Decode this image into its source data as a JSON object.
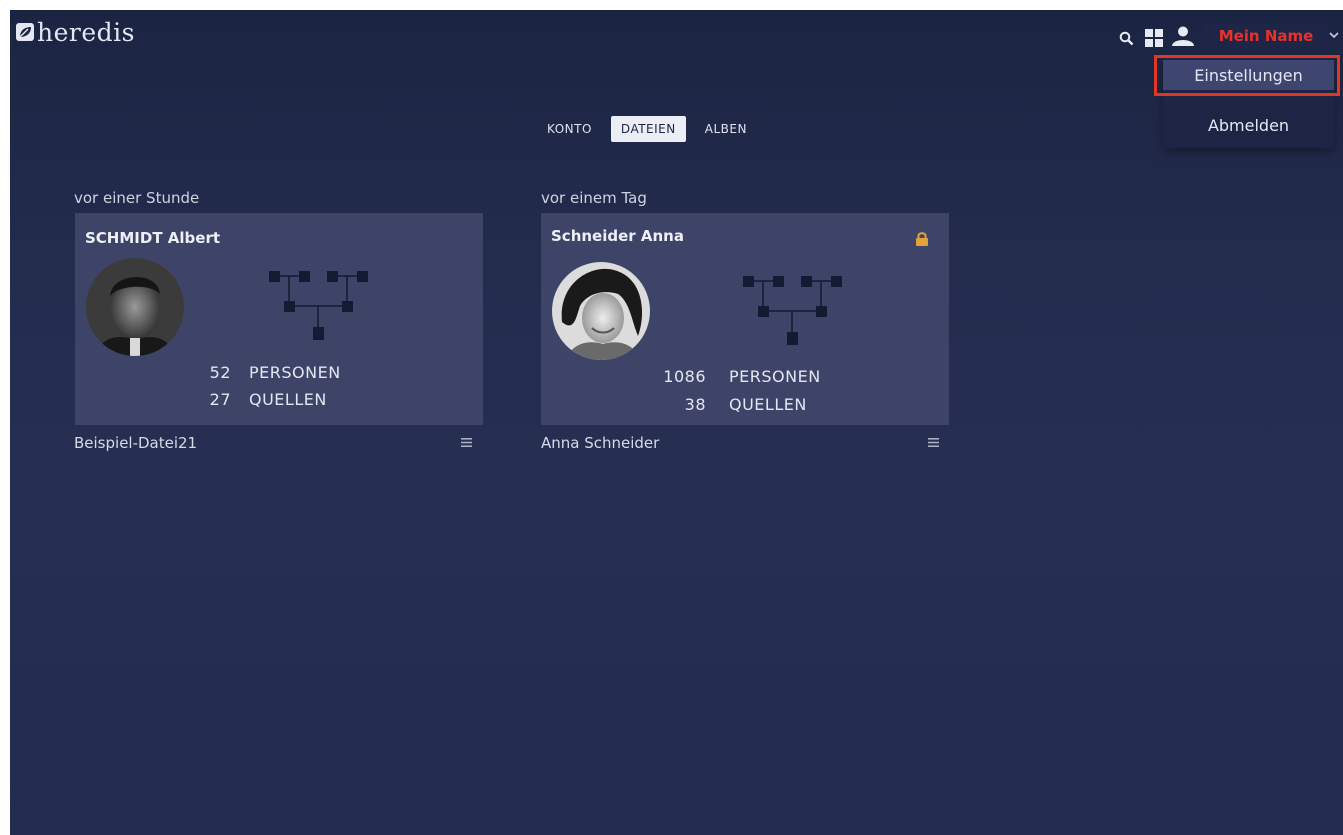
{
  "app": {
    "logo_text": "heredis",
    "user_name": "Mein Name",
    "accent_color": "#e6332a"
  },
  "user_menu": {
    "items": [
      "Einstellungen",
      "Abmelden"
    ],
    "highlighted": "Einstellungen"
  },
  "tabs": [
    {
      "label": "KONTO",
      "active": false
    },
    {
      "label": "DATEIEN",
      "active": true
    },
    {
      "label": "ALBEN",
      "active": false
    }
  ],
  "files": [
    {
      "when": "vor einer Stunde",
      "person": "SCHMIDT Albert",
      "persons_count": "52",
      "persons_label": "PERSONEN",
      "sources_count": "27",
      "sources_label": "QUELLEN",
      "file_name": "Beispiel-Datei21",
      "locked": false
    },
    {
      "when": "vor einem Tag",
      "person": "Schneider Anna",
      "persons_count": "1086",
      "persons_label": "PERSONEN",
      "sources_count": "38",
      "sources_label": "QUELLEN",
      "file_name": "Anna Schneider",
      "locked": true
    }
  ]
}
